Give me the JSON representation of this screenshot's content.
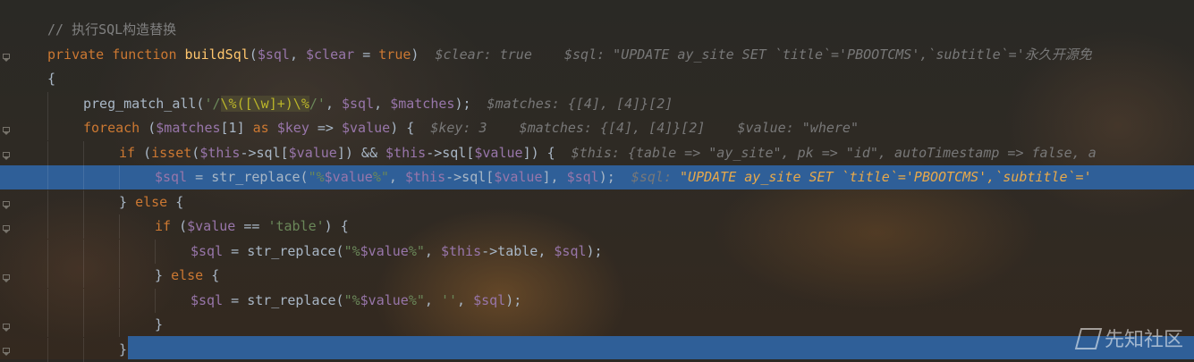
{
  "editor": {
    "lines": [
      {
        "indent": 0,
        "tokens": [
          {
            "t": "// 执行SQL构造替换",
            "c": "cmt"
          }
        ]
      },
      {
        "indent": 0,
        "tokens": [
          {
            "t": "private ",
            "c": "kw"
          },
          {
            "t": "function ",
            "c": "kw"
          },
          {
            "t": "buildSql",
            "c": "fn"
          },
          {
            "t": "(",
            "c": "plain"
          },
          {
            "t": "$sql",
            "c": "var"
          },
          {
            "t": ", ",
            "c": "plain"
          },
          {
            "t": "$clear",
            "c": "var"
          },
          {
            "t": " = ",
            "c": "plain"
          },
          {
            "t": "true",
            "c": "kw"
          },
          {
            "t": ")",
            "c": "plain"
          },
          {
            "t": "  $clear: true    $sql: \"UPDATE ay_site SET `title`='PBOOTCMS',`subtitle`='永久开源免",
            "c": "hint"
          }
        ]
      },
      {
        "indent": 0,
        "tokens": [
          {
            "t": "{",
            "c": "plain"
          }
        ]
      },
      {
        "indent": 1,
        "tokens": [
          {
            "t": "preg_match_all(",
            "c": "plain"
          },
          {
            "t": "'/",
            "c": "str"
          },
          {
            "t": "\\%([\\w]+)\\%",
            "c": "regex-hl"
          },
          {
            "t": "/'",
            "c": "str"
          },
          {
            "t": ", ",
            "c": "plain"
          },
          {
            "t": "$sql",
            "c": "var"
          },
          {
            "t": ", ",
            "c": "plain"
          },
          {
            "t": "$matches",
            "c": "var"
          },
          {
            "t": ");",
            "c": "plain"
          },
          {
            "t": "  $matches: {[4], [4]}[2]",
            "c": "hint"
          }
        ]
      },
      {
        "indent": 1,
        "tokens": [
          {
            "t": "foreach ",
            "c": "kw"
          },
          {
            "t": "(",
            "c": "plain"
          },
          {
            "t": "$matches",
            "c": "var"
          },
          {
            "t": "[1] ",
            "c": "plain"
          },
          {
            "t": "as ",
            "c": "kw"
          },
          {
            "t": "$key",
            "c": "var"
          },
          {
            "t": " => ",
            "c": "plain"
          },
          {
            "t": "$value",
            "c": "var"
          },
          {
            "t": ") {",
            "c": "plain"
          },
          {
            "t": "  $key: 3    $matches: {[4], [4]}[2]    $value: \"where\"",
            "c": "hint"
          }
        ]
      },
      {
        "indent": 2,
        "tokens": [
          {
            "t": "if ",
            "c": "kw"
          },
          {
            "t": "(",
            "c": "plain"
          },
          {
            "t": "isset",
            "c": "kw"
          },
          {
            "t": "(",
            "c": "plain"
          },
          {
            "t": "$this",
            "c": "var"
          },
          {
            "t": "->sql[",
            "c": "plain"
          },
          {
            "t": "$value",
            "c": "var"
          },
          {
            "t": "]) && ",
            "c": "plain"
          },
          {
            "t": "$this",
            "c": "var"
          },
          {
            "t": "->sql[",
            "c": "plain"
          },
          {
            "t": "$value",
            "c": "var"
          },
          {
            "t": "]) {",
            "c": "plain"
          },
          {
            "t": "  $this: {table => \"ay_site\", pk => \"id\", autoTimestamp => false, a",
            "c": "hint"
          }
        ]
      },
      {
        "indent": 3,
        "current": true,
        "tokens": [
          {
            "t": "$sql",
            "c": "var"
          },
          {
            "t": " = str_replace(",
            "c": "plain"
          },
          {
            "t": "\"%",
            "c": "str"
          },
          {
            "t": "$value",
            "c": "var"
          },
          {
            "t": "%\"",
            "c": "str"
          },
          {
            "t": ", ",
            "c": "plain"
          },
          {
            "t": "$this",
            "c": "var"
          },
          {
            "t": "->sql[",
            "c": "plain"
          },
          {
            "t": "$value",
            "c": "var"
          },
          {
            "t": "], ",
            "c": "plain"
          },
          {
            "t": "$sql",
            "c": "var"
          },
          {
            "t": ");",
            "c": "plain"
          },
          {
            "t": "  $sql: ",
            "c": "hint"
          },
          {
            "t": "\"UPDATE ay_site SET `title`='PBOOTCMS',`subtitle`='",
            "c": "hint-hl"
          }
        ]
      },
      {
        "indent": 2,
        "tokens": [
          {
            "t": "} ",
            "c": "plain"
          },
          {
            "t": "else ",
            "c": "kw"
          },
          {
            "t": "{",
            "c": "plain"
          }
        ]
      },
      {
        "indent": 3,
        "tokens": [
          {
            "t": "if ",
            "c": "kw"
          },
          {
            "t": "(",
            "c": "plain"
          },
          {
            "t": "$value",
            "c": "var"
          },
          {
            "t": " == ",
            "c": "plain"
          },
          {
            "t": "'table'",
            "c": "str"
          },
          {
            "t": ") {",
            "c": "plain"
          }
        ]
      },
      {
        "indent": 4,
        "tokens": [
          {
            "t": "$sql",
            "c": "var"
          },
          {
            "t": " = str_replace(",
            "c": "plain"
          },
          {
            "t": "\"%",
            "c": "str"
          },
          {
            "t": "$value",
            "c": "var"
          },
          {
            "t": "%\"",
            "c": "str"
          },
          {
            "t": ", ",
            "c": "plain"
          },
          {
            "t": "$this",
            "c": "var"
          },
          {
            "t": "->table, ",
            "c": "plain"
          },
          {
            "t": "$sql",
            "c": "var"
          },
          {
            "t": ");",
            "c": "plain"
          }
        ]
      },
      {
        "indent": 3,
        "tokens": [
          {
            "t": "} ",
            "c": "plain"
          },
          {
            "t": "else ",
            "c": "kw"
          },
          {
            "t": "{",
            "c": "plain"
          }
        ]
      },
      {
        "indent": 4,
        "tokens": [
          {
            "t": "$sql",
            "c": "var"
          },
          {
            "t": " = str_replace(",
            "c": "plain"
          },
          {
            "t": "\"%",
            "c": "str"
          },
          {
            "t": "$value",
            "c": "var"
          },
          {
            "t": "%\"",
            "c": "str"
          },
          {
            "t": ", ",
            "c": "plain"
          },
          {
            "t": "''",
            "c": "str"
          },
          {
            "t": ", ",
            "c": "plain"
          },
          {
            "t": "$sql",
            "c": "var"
          },
          {
            "t": ");",
            "c": "plain"
          }
        ]
      },
      {
        "indent": 3,
        "tokens": [
          {
            "t": "}",
            "c": "plain"
          }
        ]
      },
      {
        "indent": 2,
        "tokens": [
          {
            "t": "}",
            "c": "plain"
          }
        ]
      }
    ]
  },
  "watermark": {
    "text": "先知社区",
    "icon": "xianzhi-logo-icon"
  }
}
